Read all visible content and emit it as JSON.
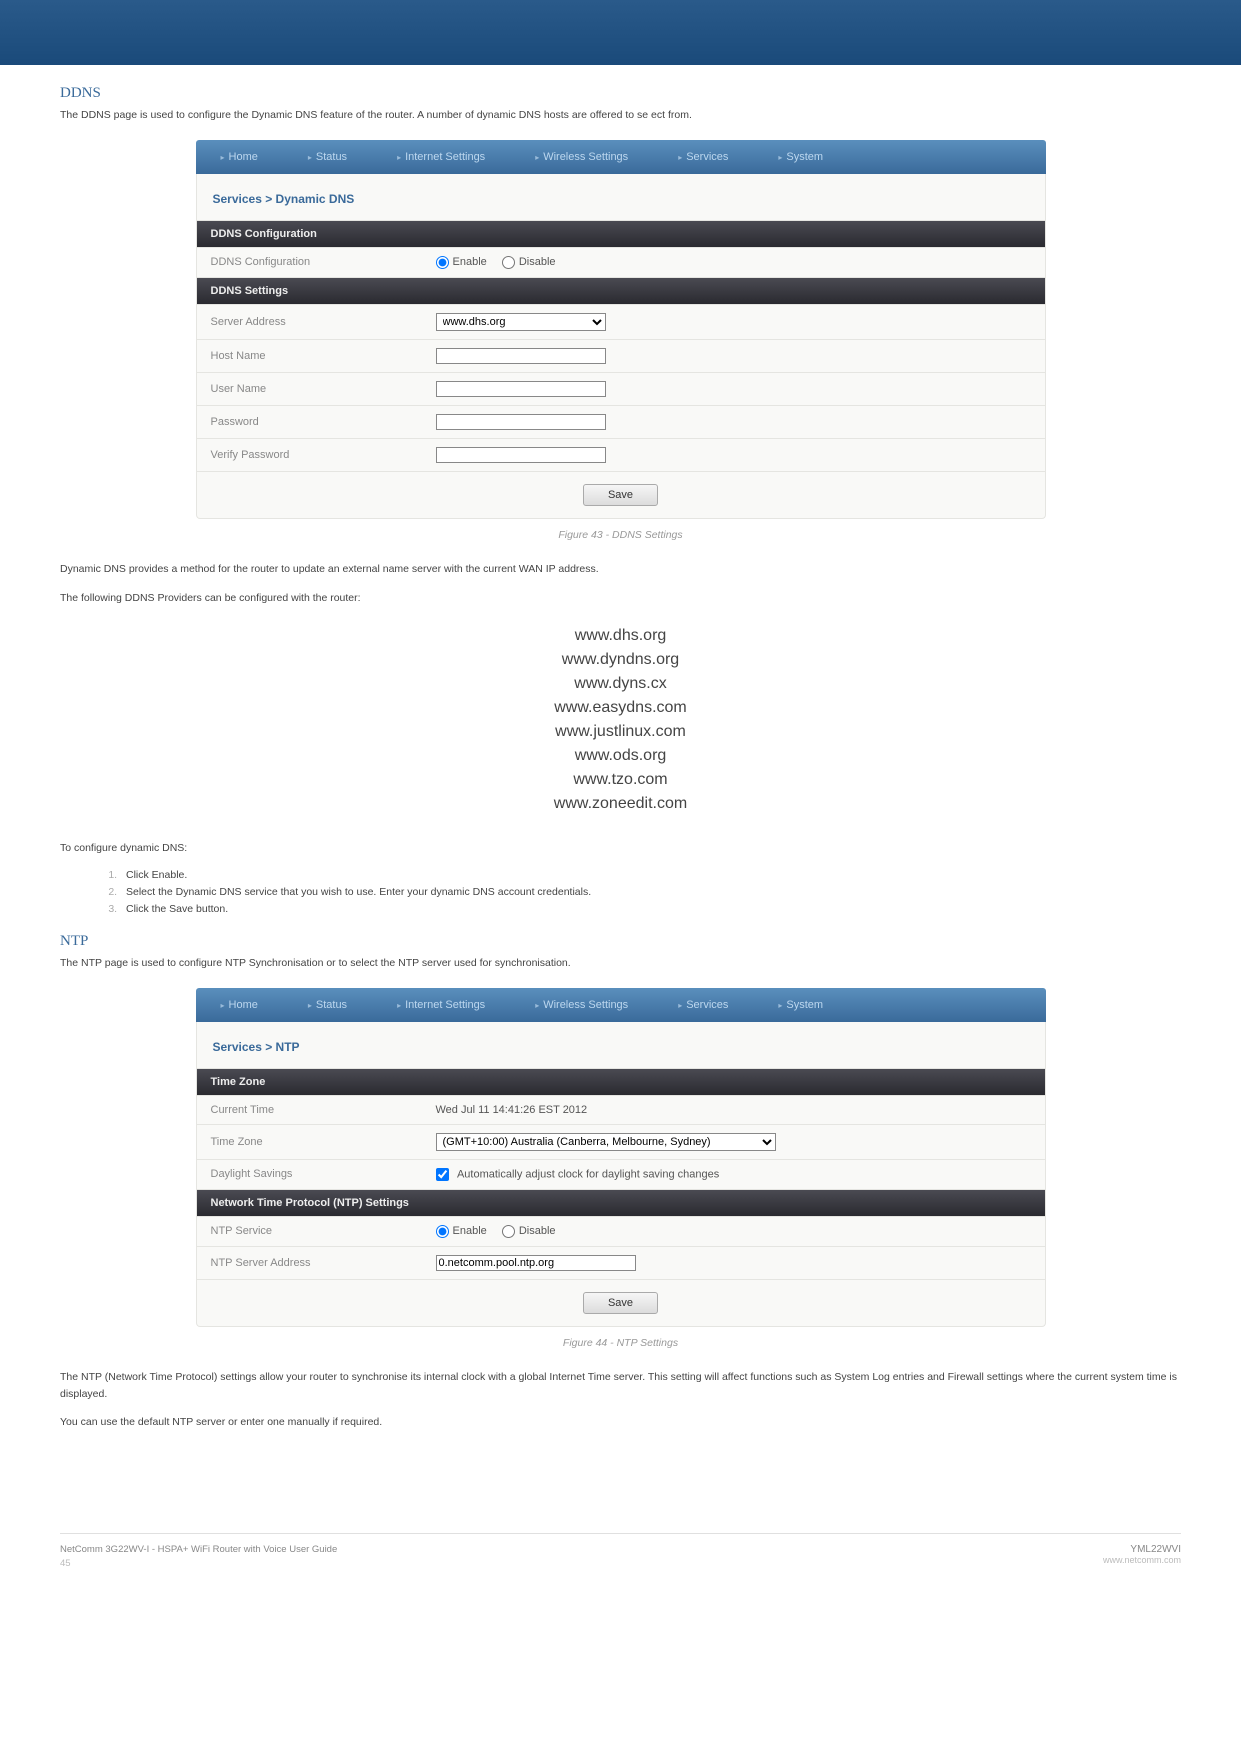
{
  "ddns": {
    "title": "DDNS",
    "intro": "The DDNS page is used to configure the Dynamic DNS feature of the router. A number of dynamic DNS hosts are offered to se ect from.",
    "nav": [
      "Home",
      "Status",
      "Internet Settings",
      "Wireless Settings",
      "Services",
      "System"
    ],
    "breadcrumb": "Services > Dynamic DNS",
    "bar_config": "DDNS Configuration",
    "row_config_label": "DDNS Configuration",
    "radio_enable": "Enable",
    "radio_disable": "Disable",
    "bar_settings": "DDNS Settings",
    "row_server_label": "Server Address",
    "server_value": "www.dhs.org",
    "row_host_label": "Host Name",
    "row_user_label": "User Name",
    "row_pass_label": "Password",
    "row_verify_label": "Verify Password",
    "save_label": "Save",
    "caption": "Figure 43 - DDNS Settings",
    "desc1": "Dynamic DNS provides a method for the router to update an external name server with the current WAN IP address.",
    "desc2": "The following DDNS Providers can be configured with the router:",
    "providers": [
      "www.dhs.org",
      "www.dyndns.org",
      "www.dyns.cx",
      "www.easydns.com",
      "www.justlinux.com",
      "www.ods.org",
      "www.tzo.com",
      "www.zoneedit.com"
    ],
    "steps_intro": "To configure dynamic DNS:",
    "steps": [
      "Click Enable.",
      "Select the Dynamic DNS service that you wish to use. Enter your dynamic DNS account credentials.",
      "Click the Save button."
    ]
  },
  "ntp": {
    "title": "NTP",
    "intro": "The NTP page is used to configure NTP Synchronisation or to select the NTP server used for synchronisation.",
    "nav": [
      "Home",
      "Status",
      "Internet Settings",
      "Wireless Settings",
      "Services",
      "System"
    ],
    "breadcrumb": "Services > NTP",
    "bar_tz": "Time Zone",
    "row_current_label": "Current Time",
    "current_value": "Wed Jul 11 14:41:26 EST 2012",
    "row_tz_label": "Time Zone",
    "tz_value": "(GMT+10:00) Australia (Canberra, Melbourne, Sydney)",
    "row_dst_label": "Daylight Savings",
    "dst_text": "Automatically adjust clock for daylight saving changes",
    "bar_ntp": "Network Time Protocol (NTP) Settings",
    "row_service_label": "NTP Service",
    "radio_enable": "Enable",
    "radio_disable": "Disable",
    "row_server_label": "NTP Server Address",
    "server_value": "0.netcomm.pool.ntp.org",
    "save_label": "Save",
    "caption": "Figure 44 - NTP Settings",
    "desc1": "The NTP (Network Time Protocol) settings allow your router to synchronise its internal clock with a global Internet Time server. This setting will affect functions such as System Log entries and Firewall settings where the current system time is displayed.",
    "desc2": "You can use the default NTP server or enter one manually if required."
  },
  "footer": {
    "guide": "NetComm 3G22WV-I - HSPA+ WiFi Router with Voice User Guide",
    "page": "45",
    "model": "YML22WVI",
    "site": "www.netcomm.com"
  }
}
